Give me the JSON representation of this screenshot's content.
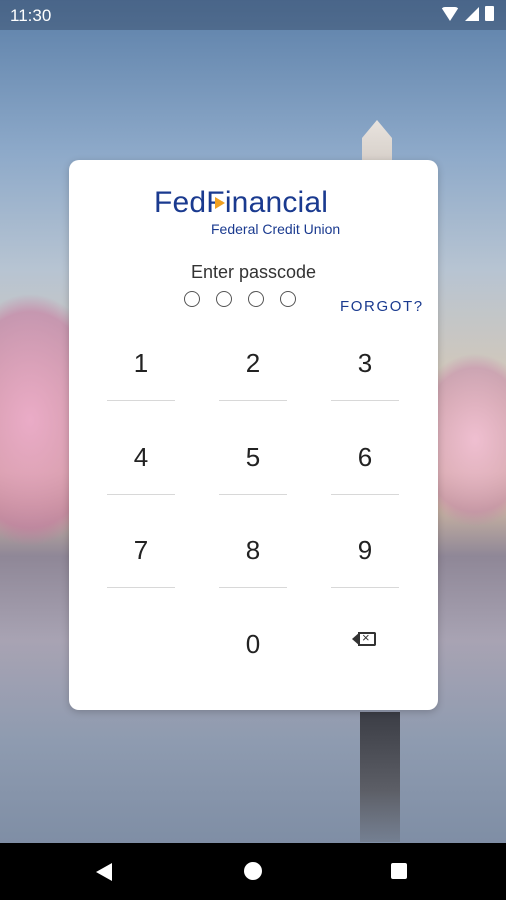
{
  "status_bar": {
    "time": "11:30"
  },
  "logo": {
    "name": "FedFinancial",
    "subtitle": "Federal Credit Union"
  },
  "passcode": {
    "prompt": "Enter passcode",
    "forgot_label": "FORGOT?",
    "dots_filled": 0,
    "dots_total": 4
  },
  "keypad": {
    "keys": [
      "1",
      "2",
      "3",
      "4",
      "5",
      "6",
      "7",
      "8",
      "9",
      "0"
    ],
    "backspace_icon": "backspace-icon"
  },
  "nav": {
    "back_icon": "back-icon",
    "home_icon": "home-icon",
    "recent_icon": "recent-apps-icon"
  }
}
